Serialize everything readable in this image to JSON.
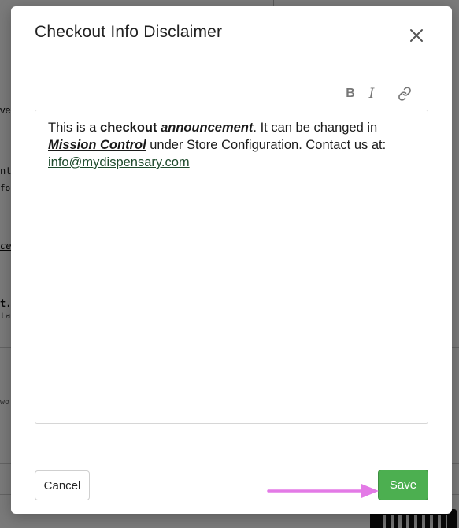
{
  "background": {
    "fragments": [
      "ve",
      "nt",
      "fo",
      "ce",
      "t.",
      "ta",
      "wo"
    ]
  },
  "modal": {
    "title": "Checkout Info Disclaimer",
    "toolbar": {
      "bold_label": "B",
      "italic_label": "I",
      "link_icon": "link-icon"
    },
    "editor": {
      "text_1": "This is a ",
      "bold_1": "checkout",
      "text_2": " ",
      "bold_italic_1": "announcement",
      "text_3": ". It can be changed in ",
      "bold_italic_underline_1": "Mission Control",
      "text_4": " under Store Configuration. Contact us at: ",
      "link_text": "info@mydispensary.com"
    },
    "footer": {
      "cancel_label": "Cancel",
      "save_label": "Save"
    }
  },
  "colors": {
    "save_green": "#4caf50",
    "link_green": "#1e4a2c",
    "arrow_magenta": "#e37ae6"
  }
}
